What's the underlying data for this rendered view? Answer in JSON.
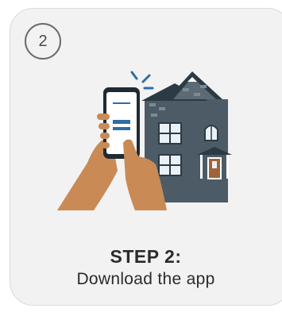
{
  "step": {
    "number": "2",
    "title": "STEP 2:",
    "description": "Download the app"
  },
  "illustration": {
    "icon": "hands-holding-phone-with-house",
    "colors": {
      "house": "#4c5b66",
      "roof": "#2c3a44",
      "skin": "#c98a56",
      "phone": "#1f2a33",
      "accent_blue": "#2e6da4",
      "door": "#a0633a"
    }
  }
}
